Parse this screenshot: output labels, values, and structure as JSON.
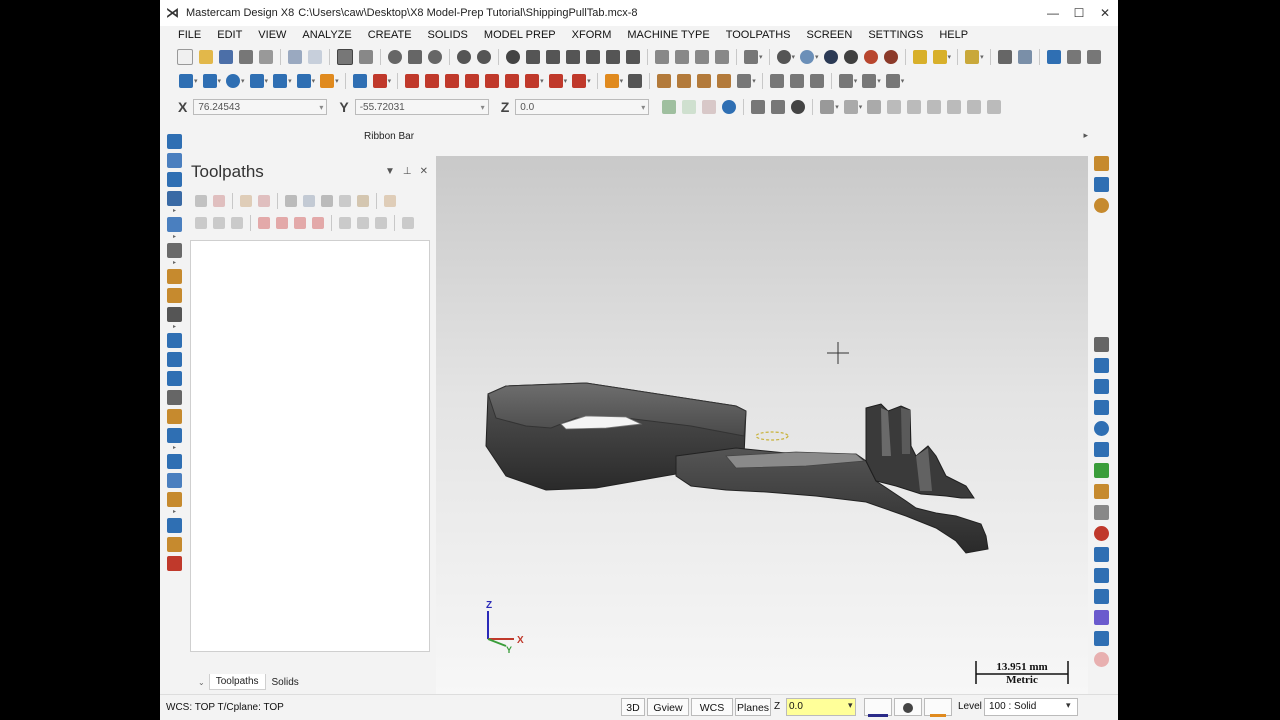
{
  "window": {
    "app_title": "Mastercam Design X8",
    "file_path": "C:\\Users\\caw\\Desktop\\X8 Model-Prep Tutorial\\ShippingPullTab.mcx-8"
  },
  "menu": [
    "FILE",
    "EDIT",
    "VIEW",
    "ANALYZE",
    "CREATE",
    "SOLIDS",
    "MODEL PREP",
    "XFORM",
    "MACHINE TYPE",
    "TOOLPATHS",
    "SCREEN",
    "SETTINGS",
    "HELP"
  ],
  "coords": {
    "x_label": "X",
    "x_value": "76.24543",
    "y_label": "Y",
    "y_value": "-55.72031",
    "z_label": "Z",
    "z_value": "0.0"
  },
  "ribbon_bar": {
    "label": "Ribbon Bar"
  },
  "panel": {
    "title": "Toolpaths",
    "tabs": [
      "Toolpaths",
      "Solids"
    ],
    "active_tab": "Toolpaths"
  },
  "viewport": {
    "axis_z": "Z",
    "axis_x": "X",
    "axis_y": "Y",
    "scale_value": "13.951 mm",
    "scale_units": "Metric"
  },
  "status": {
    "wcs_text": "WCS: TOP  T/Cplane: TOP",
    "btn_3d": "3D",
    "btn_gview": "Gview",
    "btn_wcs": "WCS",
    "btn_planes": "Planes",
    "z_label": "Z",
    "z_value": "0.0",
    "level_label": "Level",
    "level_value": "100 : Solid"
  },
  "colors": {
    "accent_green": "#3a9d3a",
    "accent_blue": "#2f6fb3",
    "accent_red": "#c0392b",
    "accent_orange": "#e08a1e",
    "accent_yellow": "#d8b02a",
    "z_field_bg": "#ffff99"
  }
}
